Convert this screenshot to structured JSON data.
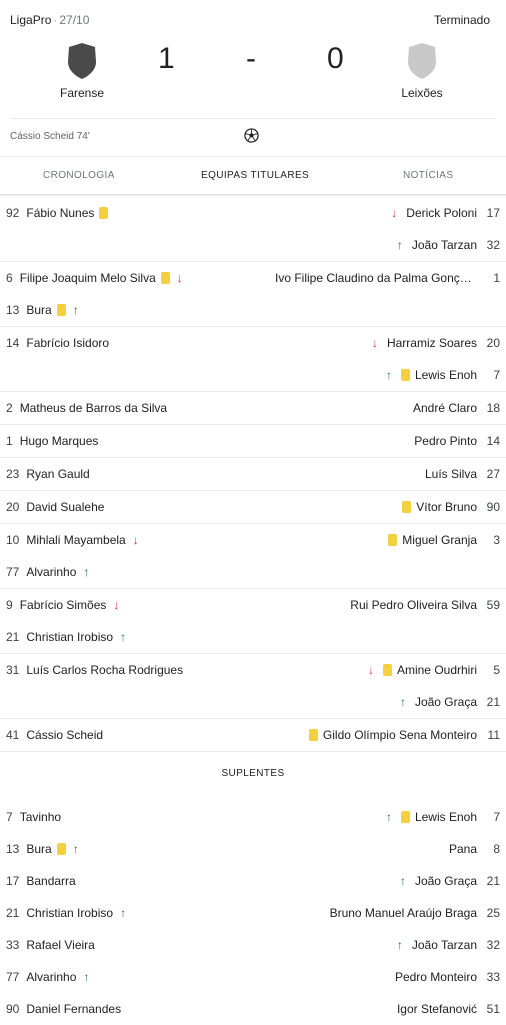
{
  "match": {
    "competition": "LigaPro",
    "separator": "·",
    "date": "27/10",
    "status": "Terminado",
    "home": {
      "name": "Farense",
      "score": "1",
      "crest_color": "#4a4a4a"
    },
    "away": {
      "name": "Leixões",
      "score": "0",
      "crest_color": "#c8c8c8"
    },
    "dash": "-",
    "goal_scorer": "Cássio Scheid 74'",
    "goal_icon": "soccer-ball-icon"
  },
  "tabs": [
    {
      "label": "CRONOLOGIA",
      "active": false
    },
    {
      "label": "EQUIPAS TITULARES",
      "active": true
    },
    {
      "label": "NOTÍCIAS",
      "active": false
    }
  ],
  "colors": {
    "yellow_card": "#f4d03f",
    "sub_out": "#d93025",
    "sub_in": "#188038"
  },
  "starters": [
    {
      "rows": [
        {
          "left": {
            "num": "92",
            "name": "Fábio Nunes",
            "card": true
          },
          "right": {
            "num": "17",
            "name": "Derick Poloni",
            "out": true
          }
        },
        {
          "right": {
            "num": "32",
            "name": "João Tarzan",
            "in": true
          }
        }
      ]
    },
    {
      "rows": [
        {
          "left": {
            "num": "6",
            "name": "Filipe Joaquim Melo Silva",
            "card": true,
            "out": true
          },
          "right": {
            "num": "1",
            "name": "Ivo Filipe Claudino da Palma Gonçalves",
            "trunc": true
          }
        },
        {
          "left": {
            "num": "13",
            "name": "Bura",
            "card": true,
            "in": true
          }
        }
      ]
    },
    {
      "rows": [
        {
          "left": {
            "num": "14",
            "name": "Fabrício Isidoro"
          },
          "right": {
            "num": "20",
            "name": "Harramiz Soares",
            "out": true
          }
        },
        {
          "right": {
            "num": "7",
            "name": "Lewis Enoh",
            "card": true,
            "in": true
          }
        }
      ]
    },
    {
      "rows": [
        {
          "left": {
            "num": "2",
            "name": "Matheus de Barros da Silva"
          },
          "right": {
            "num": "18",
            "name": "André Claro"
          }
        }
      ]
    },
    {
      "rows": [
        {
          "left": {
            "num": "1",
            "name": "Hugo Marques"
          },
          "right": {
            "num": "14",
            "name": "Pedro Pinto"
          }
        }
      ]
    },
    {
      "rows": [
        {
          "left": {
            "num": "23",
            "name": "Ryan Gauld"
          },
          "right": {
            "num": "27",
            "name": "Luís Silva"
          }
        }
      ]
    },
    {
      "rows": [
        {
          "left": {
            "num": "20",
            "name": "David Sualehe"
          },
          "right": {
            "num": "90",
            "name": "Vítor Bruno",
            "card": true
          }
        }
      ]
    },
    {
      "rows": [
        {
          "left": {
            "num": "10",
            "name": "Mihlali Mayambela",
            "out": true
          },
          "right": {
            "num": "3",
            "name": "Miguel Granja",
            "card": true
          }
        },
        {
          "left": {
            "num": "77",
            "name": "Alvarinho",
            "in": true
          }
        }
      ]
    },
    {
      "rows": [
        {
          "left": {
            "num": "9",
            "name": "Fabrício Simões",
            "out": true
          },
          "right": {
            "num": "59",
            "name": "Rui Pedro Oliveira Silva"
          }
        },
        {
          "left": {
            "num": "21",
            "name": "Christian Irobiso",
            "in": true
          }
        }
      ]
    },
    {
      "rows": [
        {
          "left": {
            "num": "31",
            "name": "Luís Carlos Rocha Rodrigues"
          },
          "right": {
            "num": "5",
            "name": "Amine Oudrhiri",
            "card": true,
            "out": true
          }
        },
        {
          "right": {
            "num": "21",
            "name": "João Graça",
            "in": true
          }
        }
      ]
    },
    {
      "rows": [
        {
          "left": {
            "num": "41",
            "name": "Cássio Scheid"
          },
          "right": {
            "num": "11",
            "name": "Gildo Olímpio Sena Monteiro",
            "card": true
          }
        }
      ]
    }
  ],
  "subs_title": "SUPLENTES",
  "subs": [
    {
      "left": {
        "num": "7",
        "name": "Tavinho"
      },
      "right": {
        "num": "7",
        "name": "Lewis Enoh",
        "card": true,
        "in": true
      }
    },
    {
      "left": {
        "num": "13",
        "name": "Bura",
        "card": true,
        "in": true
      },
      "right": {
        "num": "8",
        "name": "Pana"
      }
    },
    {
      "left": {
        "num": "17",
        "name": "Bandarra"
      },
      "right": {
        "num": "21",
        "name": "João Graça",
        "in": true
      }
    },
    {
      "left": {
        "num": "21",
        "name": "Christian Irobiso",
        "in": true
      },
      "right": {
        "num": "25",
        "name": "Bruno Manuel Araújo Braga"
      }
    },
    {
      "left": {
        "num": "33",
        "name": "Rafael Vieira"
      },
      "right": {
        "num": "32",
        "name": "João Tarzan",
        "in": true
      }
    },
    {
      "left": {
        "num": "77",
        "name": "Alvarinho",
        "in": true
      },
      "right": {
        "num": "33",
        "name": "Pedro Monteiro"
      }
    },
    {
      "left": {
        "num": "90",
        "name": "Daniel Fernandes"
      },
      "right": {
        "num": "51",
        "name": "Igor Stefanović"
      }
    }
  ]
}
